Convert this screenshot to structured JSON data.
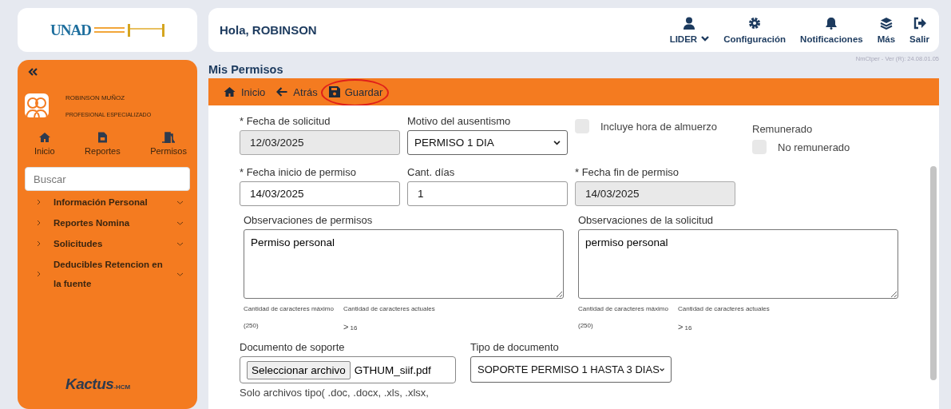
{
  "logo": {
    "text": "UNAD"
  },
  "header": {
    "greeting": "Hola, ROBINSON",
    "actions": [
      {
        "kind": "user",
        "label": "LIDER",
        "caret": true
      },
      {
        "kind": "gear",
        "label": "Configuración",
        "caret": false
      },
      {
        "kind": "bell",
        "label": "Notificaciones",
        "caret": false
      },
      {
        "kind": "layers",
        "label": "Más",
        "caret": false
      },
      {
        "kind": "exit",
        "label": "Salir",
        "caret": false
      }
    ]
  },
  "sidebar": {
    "user": {
      "name": "ROBINSON MUÑOZ",
      "role": "PROFESIONAL ESPECIALIZADO"
    },
    "shortcuts": [
      {
        "kind": "home",
        "label": "Inicio"
      },
      {
        "kind": "file",
        "label": "Reportes"
      },
      {
        "kind": "door",
        "label": "Permisos"
      }
    ],
    "search": {
      "placeholder": "Buscar"
    },
    "menu": [
      {
        "label": "Información Personal"
      },
      {
        "label": "Reportes Nomina"
      },
      {
        "label": "Solicitudes"
      },
      {
        "label": "Deducibles Retencion en la fuente"
      }
    ],
    "brand": {
      "name": "Kactus",
      "suffix": "-HCM"
    }
  },
  "page": {
    "title": "Mis Permisos",
    "version": "NmCtper - Ver (R): 24.08.01.05"
  },
  "toolbar": [
    {
      "kind": "home",
      "label": "Inicio",
      "circled": false
    },
    {
      "kind": "back",
      "label": "Atrás",
      "circled": false
    },
    {
      "kind": "save",
      "label": "Guardar",
      "circled": true
    }
  ],
  "form": {
    "row_1": [
      {
        "kind": "input",
        "label": "* Fecha de solicitud",
        "value": "12/03/2025",
        "disabled": true
      },
      {
        "kind": "select",
        "label": "Motivo del ausentismo",
        "value": "PERMISO 1 DIA"
      },
      {
        "kind": "checkbox",
        "label": "Incluye hora de almuerzo",
        "checked": false
      },
      {
        "kind": "toggle",
        "label": "Remunerado",
        "option": "No remunerado",
        "checked": false
      }
    ],
    "row_2": [
      {
        "kind": "input",
        "label": "* Fecha inicio de permiso",
        "value": "14/03/2025",
        "disabled": false
      },
      {
        "kind": "input",
        "label": "Cant. días",
        "value": "1",
        "disabled": false
      },
      {
        "kind": "input",
        "label": "* Fecha fin de permiso",
        "value": "14/03/2025",
        "disabled": true
      }
    ],
    "textareas": [
      {
        "label": "Observaciones de permisos",
        "value": "Permiso personal",
        "max_label": "Cantidad de caracteres máximo",
        "current_label": "Cantidad de caracteres actuales",
        "max": "(250)",
        "arrow": ">",
        "current": "16"
      },
      {
        "label": "Observaciones de la solicitud",
        "value": "permiso personal",
        "max_label": "Cantidad de caracteres máximo",
        "current_label": "Cantidad de caracteres actuales",
        "max": "(250)",
        "arrow": ">",
        "current": "16"
      }
    ],
    "document": {
      "label": "Documento de soporte",
      "button": "Seleccionar archivo",
      "filename": "GTHUM_siif.pdf",
      "note": "Solo archivos tipo( .doc, .docx, .xls, .xlsx,"
    },
    "document_type": {
      "label": "Tipo de documento",
      "value": "SOPORTE PERMISO 1 HASTA 3 DIAS"
    }
  }
}
